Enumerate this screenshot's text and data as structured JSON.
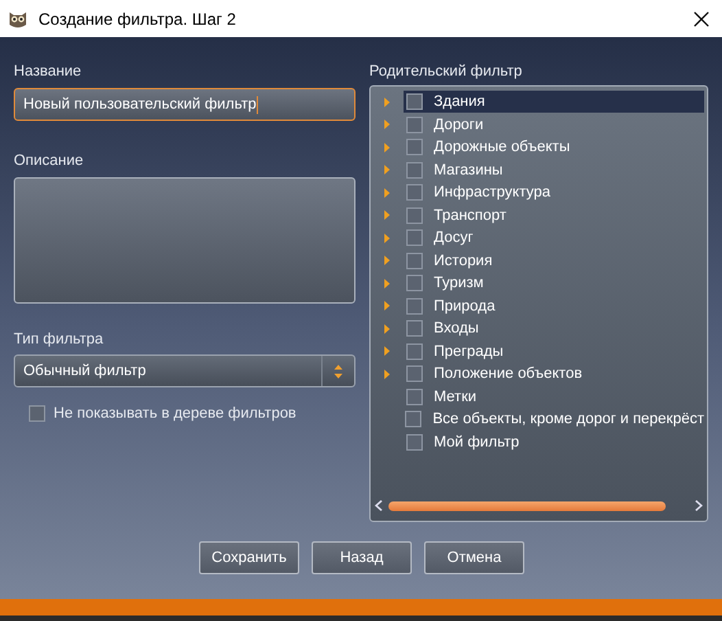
{
  "window": {
    "title": "Создание фильтра. Шаг 2"
  },
  "name": {
    "label": "Название",
    "value": "Новый пользовательский фильтр",
    "focused": true
  },
  "description": {
    "label": "Описание"
  },
  "filter_type": {
    "label": "Тип фильтра",
    "value": "Обычный фильтр"
  },
  "hide_in_tree": {
    "label": "Не показывать в дереве фильтров",
    "checked": false
  },
  "parent_filter": {
    "label": "Родительский фильтр",
    "items": [
      {
        "label": "Здания",
        "expandable": true,
        "checked": false,
        "selected": true
      },
      {
        "label": "Дороги",
        "expandable": true,
        "checked": false,
        "selected": false
      },
      {
        "label": "Дорожные объекты",
        "expandable": true,
        "checked": false,
        "selected": false
      },
      {
        "label": "Магазины",
        "expandable": true,
        "checked": false,
        "selected": false
      },
      {
        "label": "Инфраструктура",
        "expandable": true,
        "checked": false,
        "selected": false
      },
      {
        "label": "Транспорт",
        "expandable": true,
        "checked": false,
        "selected": false
      },
      {
        "label": "Досуг",
        "expandable": true,
        "checked": false,
        "selected": false
      },
      {
        "label": "История",
        "expandable": true,
        "checked": false,
        "selected": false
      },
      {
        "label": "Туризм",
        "expandable": true,
        "checked": false,
        "selected": false
      },
      {
        "label": "Природа",
        "expandable": true,
        "checked": false,
        "selected": false
      },
      {
        "label": "Входы",
        "expandable": true,
        "checked": false,
        "selected": false
      },
      {
        "label": "Преграды",
        "expandable": true,
        "checked": false,
        "selected": false
      },
      {
        "label": "Положение объектов",
        "expandable": true,
        "checked": false,
        "selected": false
      },
      {
        "label": "Метки",
        "expandable": false,
        "checked": false,
        "selected": false
      },
      {
        "label": "Все объекты, кроме дорог и перекрёст",
        "expandable": false,
        "checked": false,
        "selected": false
      },
      {
        "label": "Мой фильтр",
        "expandable": false,
        "checked": false,
        "selected": false
      }
    ]
  },
  "buttons": [
    "Сохранить",
    "Назад",
    "Отмена"
  ]
}
